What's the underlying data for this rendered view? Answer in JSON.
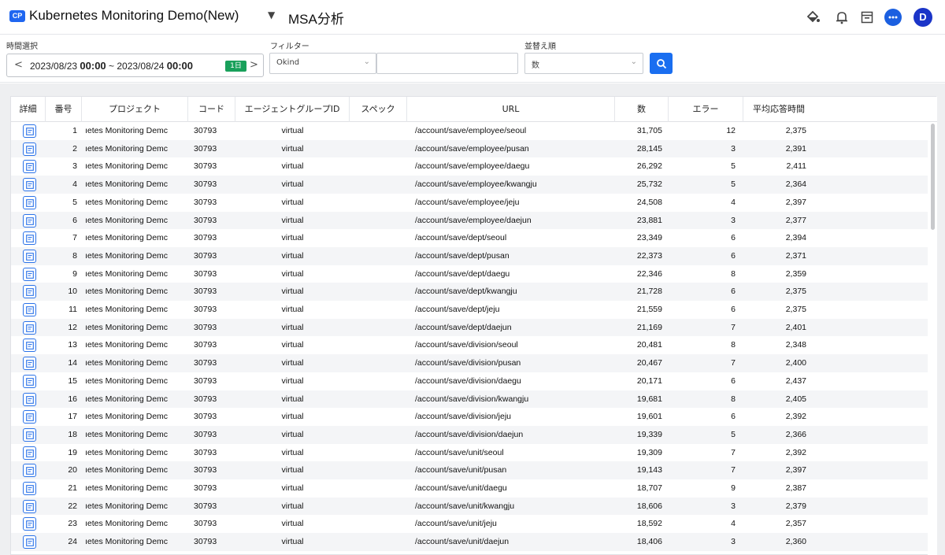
{
  "header": {
    "badge": "CP",
    "project_name": "Kubernetes Monitoring Demo(New)",
    "page_title": "MSA分析",
    "avatar_initial": "D"
  },
  "filters": {
    "time_label": "時間選択",
    "time_start_date": "2023/08/23",
    "time_start_time": "00:00",
    "time_separator": "~",
    "time_end_date": "2023/08/24",
    "time_end_time": "00:00",
    "time_range_badge": "1日",
    "filter_label": "フィルター",
    "filter_select_value": "Okind",
    "filter_input_value": "",
    "sort_label": "並替え順",
    "sort_select_value": "数"
  },
  "table": {
    "columns": [
      "詳細",
      "番号",
      "プロジェクト",
      "コード",
      "エージェントグループID",
      "スペック",
      "URL",
      "数",
      "エラー",
      "平均応答時間"
    ],
    "rows": [
      {
        "no": "1",
        "project": "ıetes Monitoring Demc",
        "code": "30793",
        "agent_group": "virtual",
        "spec": "",
        "url": "/account/save/employee/seoul",
        "count": "31,705",
        "errors": "12",
        "avg": "2,375"
      },
      {
        "no": "2",
        "project": "ıetes Monitoring Demc",
        "code": "30793",
        "agent_group": "virtual",
        "spec": "",
        "url": "/account/save/employee/pusan",
        "count": "28,145",
        "errors": "3",
        "avg": "2,391"
      },
      {
        "no": "3",
        "project": "ıetes Monitoring Demc",
        "code": "30793",
        "agent_group": "virtual",
        "spec": "",
        "url": "/account/save/employee/daegu",
        "count": "26,292",
        "errors": "5",
        "avg": "2,411"
      },
      {
        "no": "4",
        "project": "ıetes Monitoring Demc",
        "code": "30793",
        "agent_group": "virtual",
        "spec": "",
        "url": "/account/save/employee/kwangju",
        "count": "25,732",
        "errors": "5",
        "avg": "2,364"
      },
      {
        "no": "5",
        "project": "ıetes Monitoring Demc",
        "code": "30793",
        "agent_group": "virtual",
        "spec": "",
        "url": "/account/save/employee/jeju",
        "count": "24,508",
        "errors": "4",
        "avg": "2,397"
      },
      {
        "no": "6",
        "project": "ıetes Monitoring Demc",
        "code": "30793",
        "agent_group": "virtual",
        "spec": "",
        "url": "/account/save/employee/daejun",
        "count": "23,881",
        "errors": "3",
        "avg": "2,377"
      },
      {
        "no": "7",
        "project": "ıetes Monitoring Demc",
        "code": "30793",
        "agent_group": "virtual",
        "spec": "",
        "url": "/account/save/dept/seoul",
        "count": "23,349",
        "errors": "6",
        "avg": "2,394"
      },
      {
        "no": "8",
        "project": "ıetes Monitoring Demc",
        "code": "30793",
        "agent_group": "virtual",
        "spec": "",
        "url": "/account/save/dept/pusan",
        "count": "22,373",
        "errors": "6",
        "avg": "2,371"
      },
      {
        "no": "9",
        "project": "ıetes Monitoring Demc",
        "code": "30793",
        "agent_group": "virtual",
        "spec": "",
        "url": "/account/save/dept/daegu",
        "count": "22,346",
        "errors": "8",
        "avg": "2,359"
      },
      {
        "no": "10",
        "project": "ıetes Monitoring Demc",
        "code": "30793",
        "agent_group": "virtual",
        "spec": "",
        "url": "/account/save/dept/kwangju",
        "count": "21,728",
        "errors": "6",
        "avg": "2,375"
      },
      {
        "no": "11",
        "project": "ıetes Monitoring Demc",
        "code": "30793",
        "agent_group": "virtual",
        "spec": "",
        "url": "/account/save/dept/jeju",
        "count": "21,559",
        "errors": "6",
        "avg": "2,375"
      },
      {
        "no": "12",
        "project": "ıetes Monitoring Demc",
        "code": "30793",
        "agent_group": "virtual",
        "spec": "",
        "url": "/account/save/dept/daejun",
        "count": "21,169",
        "errors": "7",
        "avg": "2,401"
      },
      {
        "no": "13",
        "project": "ıetes Monitoring Demc",
        "code": "30793",
        "agent_group": "virtual",
        "spec": "",
        "url": "/account/save/division/seoul",
        "count": "20,481",
        "errors": "8",
        "avg": "2,348"
      },
      {
        "no": "14",
        "project": "ıetes Monitoring Demc",
        "code": "30793",
        "agent_group": "virtual",
        "spec": "",
        "url": "/account/save/division/pusan",
        "count": "20,467",
        "errors": "7",
        "avg": "2,400"
      },
      {
        "no": "15",
        "project": "ıetes Monitoring Demc",
        "code": "30793",
        "agent_group": "virtual",
        "spec": "",
        "url": "/account/save/division/daegu",
        "count": "20,171",
        "errors": "6",
        "avg": "2,437"
      },
      {
        "no": "16",
        "project": "ıetes Monitoring Demc",
        "code": "30793",
        "agent_group": "virtual",
        "spec": "",
        "url": "/account/save/division/kwangju",
        "count": "19,681",
        "errors": "8",
        "avg": "2,405"
      },
      {
        "no": "17",
        "project": "ıetes Monitoring Demc",
        "code": "30793",
        "agent_group": "virtual",
        "spec": "",
        "url": "/account/save/division/jeju",
        "count": "19,601",
        "errors": "6",
        "avg": "2,392"
      },
      {
        "no": "18",
        "project": "ıetes Monitoring Demc",
        "code": "30793",
        "agent_group": "virtual",
        "spec": "",
        "url": "/account/save/division/daejun",
        "count": "19,339",
        "errors": "5",
        "avg": "2,366"
      },
      {
        "no": "19",
        "project": "ıetes Monitoring Demc",
        "code": "30793",
        "agent_group": "virtual",
        "spec": "",
        "url": "/account/save/unit/seoul",
        "count": "19,309",
        "errors": "7",
        "avg": "2,392"
      },
      {
        "no": "20",
        "project": "ıetes Monitoring Demc",
        "code": "30793",
        "agent_group": "virtual",
        "spec": "",
        "url": "/account/save/unit/pusan",
        "count": "19,143",
        "errors": "7",
        "avg": "2,397"
      },
      {
        "no": "21",
        "project": "ıetes Monitoring Demc",
        "code": "30793",
        "agent_group": "virtual",
        "spec": "",
        "url": "/account/save/unit/daegu",
        "count": "18,707",
        "errors": "9",
        "avg": "2,387"
      },
      {
        "no": "22",
        "project": "ıetes Monitoring Demc",
        "code": "30793",
        "agent_group": "virtual",
        "spec": "",
        "url": "/account/save/unit/kwangju",
        "count": "18,606",
        "errors": "3",
        "avg": "2,379"
      },
      {
        "no": "23",
        "project": "ıetes Monitoring Demc",
        "code": "30793",
        "agent_group": "virtual",
        "spec": "",
        "url": "/account/save/unit/jeju",
        "count": "18,592",
        "errors": "4",
        "avg": "2,357"
      },
      {
        "no": "24",
        "project": "ıetes Monitoring Demc",
        "code": "30793",
        "agent_group": "virtual",
        "spec": "",
        "url": "/account/save/unit/daejun",
        "count": "18,406",
        "errors": "3",
        "avg": "2,360"
      }
    ]
  },
  "icons": {
    "header": [
      "paint-bucket-icon",
      "bell-icon",
      "calendar-icon",
      "chat-icon"
    ],
    "row_detail": "detail-icon"
  },
  "colors": {
    "accent": "#1a6ef0",
    "badge_green": "#19a05b",
    "avatar": "#1b35c8"
  }
}
